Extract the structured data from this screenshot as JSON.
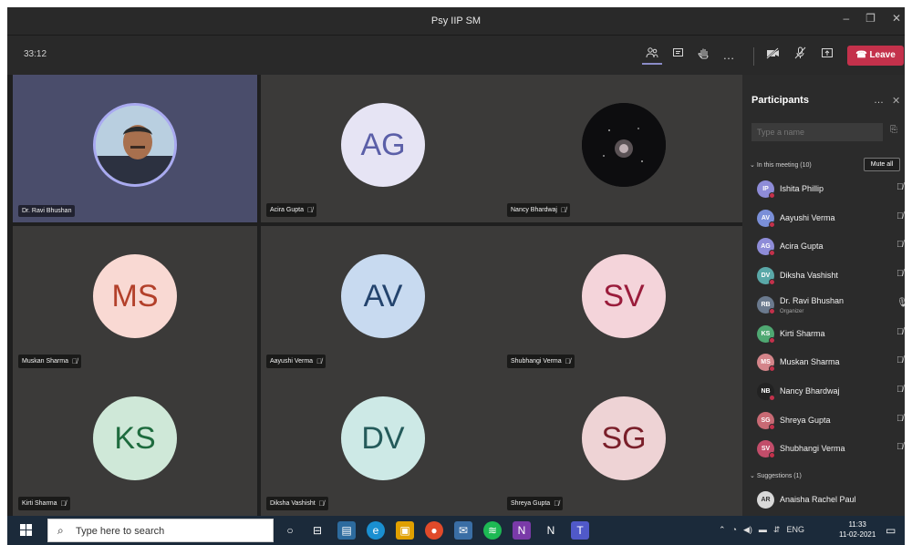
{
  "window": {
    "title": "Psy IIP SM",
    "minimize": "–",
    "maximize": "❐",
    "close": "✕"
  },
  "toolbar": {
    "timer": "33:12",
    "participants_icon": "people-icon",
    "chat_icon": "chat-icon",
    "raise_hand_icon": "hand-icon",
    "more_icon": "…",
    "camera_icon": "camera-off-icon",
    "mic_icon": "mic-off-icon",
    "share_icon": "share-tray-icon",
    "leave_label": "Leave"
  },
  "tiles": [
    {
      "name": "Dr. Ravi Bhushan",
      "initials": "",
      "kind": "photo",
      "muted": false
    },
    {
      "name": "Acira Gupta",
      "initials": "AG",
      "bg": "#e6e4f4",
      "fg": "#5b5fa8",
      "muted": true
    },
    {
      "name": "Nancy Bhardwaj",
      "initials": "",
      "kind": "dark",
      "muted": true
    },
    {
      "name": "Muskan Sharma",
      "initials": "MS",
      "bg": "#f9d9d3",
      "fg": "#b3402a",
      "muted": true
    },
    {
      "name": "Aayushi Verma",
      "initials": "AV",
      "bg": "#c8daf0",
      "fg": "#23436d",
      "muted": true
    },
    {
      "name": "Shubhangi Verma",
      "initials": "SV",
      "bg": "#f4d4da",
      "fg": "#9a1c3b",
      "muted": true
    },
    {
      "name": "Kirti Sharma",
      "initials": "KS",
      "bg": "#cfe8d8",
      "fg": "#1e6b3e",
      "muted": true
    },
    {
      "name": "Diksha Vashisht",
      "initials": "DV",
      "bg": "#cde9e6",
      "fg": "#245a5a",
      "muted": true
    },
    {
      "name": "Shreya Gupta",
      "initials": "SG",
      "bg": "#eed3d5",
      "fg": "#7a1f2a",
      "muted": true
    }
  ],
  "panel": {
    "title": "Participants",
    "more": "…",
    "close": "✕",
    "search_placeholder": "Type a name",
    "in_meeting_label": "In this meeting (10)",
    "mute_all": "Mute all",
    "suggestions_label": "Suggestions (1)",
    "participants": [
      {
        "initials": "IP",
        "name": "Ishita Phillip",
        "color": "#8e8cd8",
        "role": ""
      },
      {
        "initials": "AV",
        "name": "Aayushi Verma",
        "color": "#7a8fd8",
        "role": ""
      },
      {
        "initials": "AG",
        "name": "Acira Gupta",
        "color": "#8e8cd8",
        "role": ""
      },
      {
        "initials": "DV",
        "name": "Diksha Vashisht",
        "color": "#5aa8a8",
        "role": ""
      },
      {
        "initials": "RB",
        "name": "Dr. Ravi Bhushan",
        "color": "#6b7a8e",
        "role": "Organizer"
      },
      {
        "initials": "KS",
        "name": "Kirti Sharma",
        "color": "#4fa872",
        "role": ""
      },
      {
        "initials": "MS",
        "name": "Muskan Sharma",
        "color": "#d4858a",
        "role": ""
      },
      {
        "initials": "NB",
        "name": "Nancy Bhardwaj",
        "color": "#222222",
        "role": ""
      },
      {
        "initials": "SG",
        "name": "Shreya Gupta",
        "color": "#c86a74",
        "role": ""
      },
      {
        "initials": "SV",
        "name": "Shubhangi Verma",
        "color": "#c24d6a",
        "role": ""
      }
    ],
    "suggestion": {
      "initials": "AR",
      "name": "Anaisha Rachel Paul",
      "color": "#d8d8d8"
    }
  },
  "taskbar": {
    "search_placeholder": "Type here to search",
    "tray_lang": "ENG",
    "time": "11:33",
    "date": "11-02-2021"
  },
  "accent": "#c4314b"
}
